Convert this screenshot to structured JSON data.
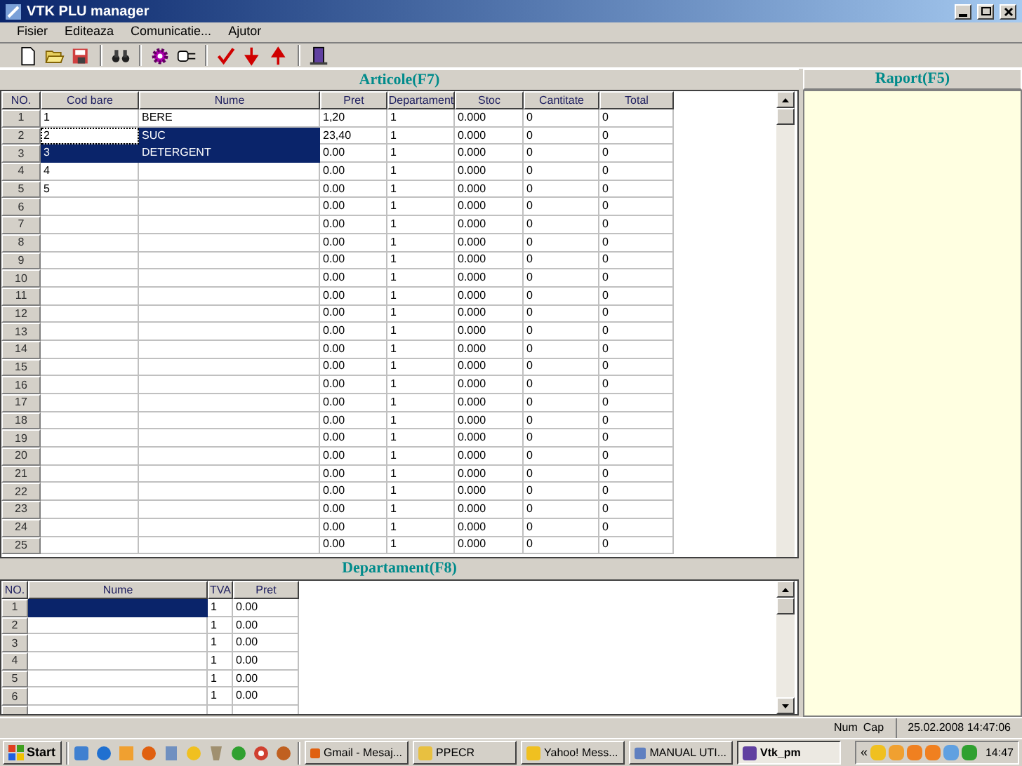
{
  "window": {
    "title": "VTK PLU manager"
  },
  "menu": [
    {
      "label": "Fisier"
    },
    {
      "label": "Editeaza"
    },
    {
      "label": "Comunicatie..."
    },
    {
      "label": "Ajutor"
    }
  ],
  "articole": {
    "title": "Articole(F7)",
    "columns": [
      "NO.",
      "Cod bare",
      "Nume",
      "Pret",
      "Departament",
      "Stoc",
      "Cantitate",
      "Total"
    ],
    "rows": [
      {
        "no": "1",
        "cod": "1",
        "nume": "BERE",
        "pret": "1,20",
        "dept": "1",
        "stoc": "0.000",
        "cant": "0",
        "total": "0",
        "cod_selected": false,
        "nume_selected": false,
        "cod_focused": false
      },
      {
        "no": "2",
        "cod": "2",
        "nume": "SUC",
        "pret": "23,40",
        "dept": "1",
        "stoc": "0.000",
        "cant": "0",
        "total": "0",
        "cod_selected": false,
        "nume_selected": true,
        "cod_focused": true
      },
      {
        "no": "3",
        "cod": "3",
        "nume": "DETERGENT",
        "pret": "0.00",
        "dept": "1",
        "stoc": "0.000",
        "cant": "0",
        "total": "0",
        "cod_selected": true,
        "nume_selected": true,
        "cod_focused": false
      },
      {
        "no": "4",
        "cod": "4",
        "pret": "0.00",
        "dept": "1",
        "stoc": "0.000",
        "cant": "0",
        "total": "0",
        "cod_selected": false,
        "nume_selected": false,
        "cod_focused": false
      },
      {
        "no": "5",
        "cod": "5",
        "pret": "0.00",
        "dept": "1",
        "stoc": "0.000",
        "cant": "0",
        "total": "0",
        "cod_selected": false,
        "nume_selected": false,
        "cod_focused": false
      },
      {
        "no": "6",
        "pret": "0.00",
        "dept": "1",
        "stoc": "0.000",
        "cant": "0",
        "total": "0",
        "cod_selected": false,
        "nume_selected": false,
        "cod_focused": false
      },
      {
        "no": "7",
        "pret": "0.00",
        "dept": "1",
        "stoc": "0.000",
        "cant": "0",
        "total": "0",
        "cod_selected": false,
        "nume_selected": false,
        "cod_focused": false
      },
      {
        "no": "8",
        "pret": "0.00",
        "dept": "1",
        "stoc": "0.000",
        "cant": "0",
        "total": "0",
        "cod_selected": false,
        "nume_selected": false,
        "cod_focused": false
      },
      {
        "no": "9",
        "pret": "0.00",
        "dept": "1",
        "stoc": "0.000",
        "cant": "0",
        "total": "0",
        "cod_selected": false,
        "nume_selected": false,
        "cod_focused": false
      },
      {
        "no": "10",
        "pret": "0.00",
        "dept": "1",
        "stoc": "0.000",
        "cant": "0",
        "total": "0",
        "cod_selected": false,
        "nume_selected": false,
        "cod_focused": false
      },
      {
        "no": "11",
        "pret": "0.00",
        "dept": "1",
        "stoc": "0.000",
        "cant": "0",
        "total": "0",
        "cod_selected": false,
        "nume_selected": false,
        "cod_focused": false
      },
      {
        "no": "12",
        "pret": "0.00",
        "dept": "1",
        "stoc": "0.000",
        "cant": "0",
        "total": "0",
        "cod_selected": false,
        "nume_selected": false,
        "cod_focused": false
      },
      {
        "no": "13",
        "pret": "0.00",
        "dept": "1",
        "stoc": "0.000",
        "cant": "0",
        "total": "0",
        "cod_selected": false,
        "nume_selected": false,
        "cod_focused": false
      },
      {
        "no": "14",
        "pret": "0.00",
        "dept": "1",
        "stoc": "0.000",
        "cant": "0",
        "total": "0",
        "cod_selected": false,
        "nume_selected": false,
        "cod_focused": false
      },
      {
        "no": "15",
        "pret": "0.00",
        "dept": "1",
        "stoc": "0.000",
        "cant": "0",
        "total": "0",
        "cod_selected": false,
        "nume_selected": false,
        "cod_focused": false
      },
      {
        "no": "16",
        "pret": "0.00",
        "dept": "1",
        "stoc": "0.000",
        "cant": "0",
        "total": "0",
        "cod_selected": false,
        "nume_selected": false,
        "cod_focused": false
      },
      {
        "no": "17",
        "pret": "0.00",
        "dept": "1",
        "stoc": "0.000",
        "cant": "0",
        "total": "0",
        "cod_selected": false,
        "nume_selected": false,
        "cod_focused": false
      },
      {
        "no": "18",
        "pret": "0.00",
        "dept": "1",
        "stoc": "0.000",
        "cant": "0",
        "total": "0",
        "cod_selected": false,
        "nume_selected": false,
        "cod_focused": false
      },
      {
        "no": "19",
        "pret": "0.00",
        "dept": "1",
        "stoc": "0.000",
        "cant": "0",
        "total": "0",
        "cod_selected": false,
        "nume_selected": false,
        "cod_focused": false
      },
      {
        "no": "20",
        "pret": "0.00",
        "dept": "1",
        "stoc": "0.000",
        "cant": "0",
        "total": "0",
        "cod_selected": false,
        "nume_selected": false,
        "cod_focused": false
      },
      {
        "no": "21",
        "pret": "0.00",
        "dept": "1",
        "stoc": "0.000",
        "cant": "0",
        "total": "0",
        "cod_selected": false,
        "nume_selected": false,
        "cod_focused": false
      },
      {
        "no": "22",
        "pret": "0.00",
        "dept": "1",
        "stoc": "0.000",
        "cant": "0",
        "total": "0",
        "cod_selected": false,
        "nume_selected": false,
        "cod_focused": false
      },
      {
        "no": "23",
        "pret": "0.00",
        "dept": "1",
        "stoc": "0.000",
        "cant": "0",
        "total": "0",
        "cod_selected": false,
        "nume_selected": false,
        "cod_focused": false
      },
      {
        "no": "24",
        "pret": "0.00",
        "dept": "1",
        "stoc": "0.000",
        "cant": "0",
        "total": "0",
        "cod_selected": false,
        "nume_selected": false,
        "cod_focused": false
      },
      {
        "no": "25",
        "pret": "0.00",
        "dept": "1",
        "stoc": "0.000",
        "cant": "0",
        "total": "0",
        "cod_selected": false,
        "nume_selected": false,
        "cod_focused": false
      }
    ]
  },
  "departament": {
    "title": "Departament(F8)",
    "columns": [
      "NO.",
      "Nume",
      "TVA",
      "Pret"
    ],
    "rows": [
      {
        "no": "1",
        "tva": "1",
        "pret": "0.00",
        "nume_selected": true
      },
      {
        "no": "2",
        "tva": "1",
        "pret": "0.00",
        "nume_selected": false
      },
      {
        "no": "3",
        "tva": "1",
        "pret": "0.00",
        "nume_selected": false
      },
      {
        "no": "4",
        "tva": "1",
        "pret": "0.00",
        "nume_selected": false
      },
      {
        "no": "5",
        "tva": "1",
        "pret": "0.00",
        "nume_selected": false
      },
      {
        "no": "6",
        "tva": "1",
        "pret": "0.00",
        "nume_selected": false
      }
    ]
  },
  "raport": {
    "title": "Raport(F5)"
  },
  "status_bar": {
    "num": "Num",
    "cap": "Cap",
    "datetime": "25.02.2008 14:47:06"
  },
  "taskbar": {
    "start": "Start",
    "tasks": [
      {
        "label": "Gmail - Mesaj...",
        "selected": false
      },
      {
        "label": "PPECR",
        "selected": false
      },
      {
        "label": "Yahoo! Mess...",
        "selected": false
      },
      {
        "label": "MANUAL UTI...",
        "selected": false
      },
      {
        "label": "Vtk_pm",
        "selected": true
      }
    ],
    "tray_toggle": "«",
    "clock": "14:47"
  }
}
